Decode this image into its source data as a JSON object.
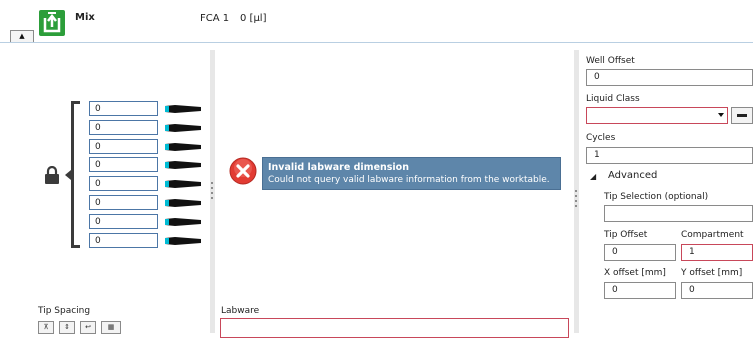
{
  "header": {
    "title": "Mix",
    "fca_label": "FCA 1",
    "fca_value": "0 [µl]"
  },
  "tips": {
    "values": [
      "0",
      "0",
      "0",
      "0",
      "0",
      "0",
      "0",
      "0"
    ]
  },
  "message": {
    "title": "Invalid labware dimension",
    "body": "Could not query valid labware information from the worktable."
  },
  "bottom": {
    "tip_spacing_label": "Tip Spacing",
    "labware_label": "Labware",
    "labware_value": ""
  },
  "settings": {
    "well_offset_label": "Well Offset",
    "well_offset_value": "0",
    "liquid_class_label": "Liquid Class",
    "liquid_class_value": "",
    "cycles_label": "Cycles",
    "cycles_value": "1",
    "advanced_label": "Advanced",
    "tip_selection_label": "Tip Selection (optional)",
    "tip_selection_value": "",
    "tip_offset_label": "Tip Offset",
    "tip_offset_value": "0",
    "compartment_label": "Compartment",
    "compartment_value": "1",
    "x_offset_label": "X offset [mm]",
    "x_offset_value": "0",
    "y_offset_label": "Y offset [mm]",
    "y_offset_value": "0"
  },
  "colors": {
    "accent": "#2c9e3a",
    "message_bg": "#5e86aa",
    "error_border": "#c8485a",
    "tip_input_border": "#4c76a6"
  },
  "icons": [
    "collapse-arrow-icon",
    "mix-icon",
    "lock-icon",
    "tip-icon",
    "error-icon",
    "dropdown-icon",
    "clear-icon",
    "expand-arrow-icon"
  ]
}
